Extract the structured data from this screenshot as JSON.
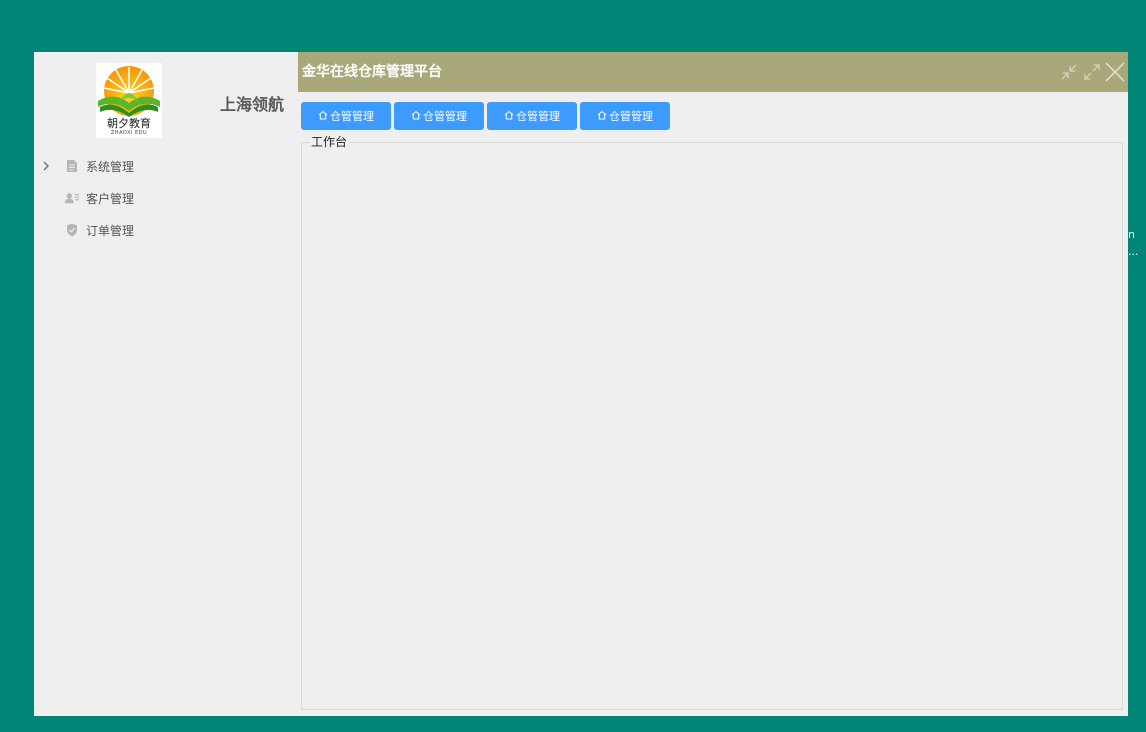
{
  "brand": {
    "logo_text": "朝夕教育",
    "logo_subtext": "ZHAOXI EDU",
    "company": "上海领航"
  },
  "menu": [
    {
      "label": "系统管理",
      "icon": "document-icon",
      "expandable": true
    },
    {
      "label": "客户管理",
      "icon": "contacts-icon",
      "expandable": false
    },
    {
      "label": "订单管理",
      "icon": "shield-icon",
      "expandable": false
    }
  ],
  "titlebar": {
    "title": "金华在线仓库管理平台",
    "controls": [
      "minimize-icon",
      "maximize-icon",
      "close-icon"
    ]
  },
  "toolbar": {
    "buttons": [
      {
        "label": "仓管管理",
        "icon": "home-icon"
      },
      {
        "label": "仓管管理",
        "icon": "home-icon"
      },
      {
        "label": "仓管管理",
        "icon": "home-icon"
      },
      {
        "label": "仓管管理",
        "icon": "home-icon"
      }
    ]
  },
  "workspace": {
    "title": "工作台"
  },
  "edge_overflow": {
    "line1": "n",
    "line2": "..."
  },
  "colors": {
    "background": "#008577",
    "panel": "#efefef",
    "titlebar": "#a9a87a",
    "button": "#3d9bff"
  }
}
